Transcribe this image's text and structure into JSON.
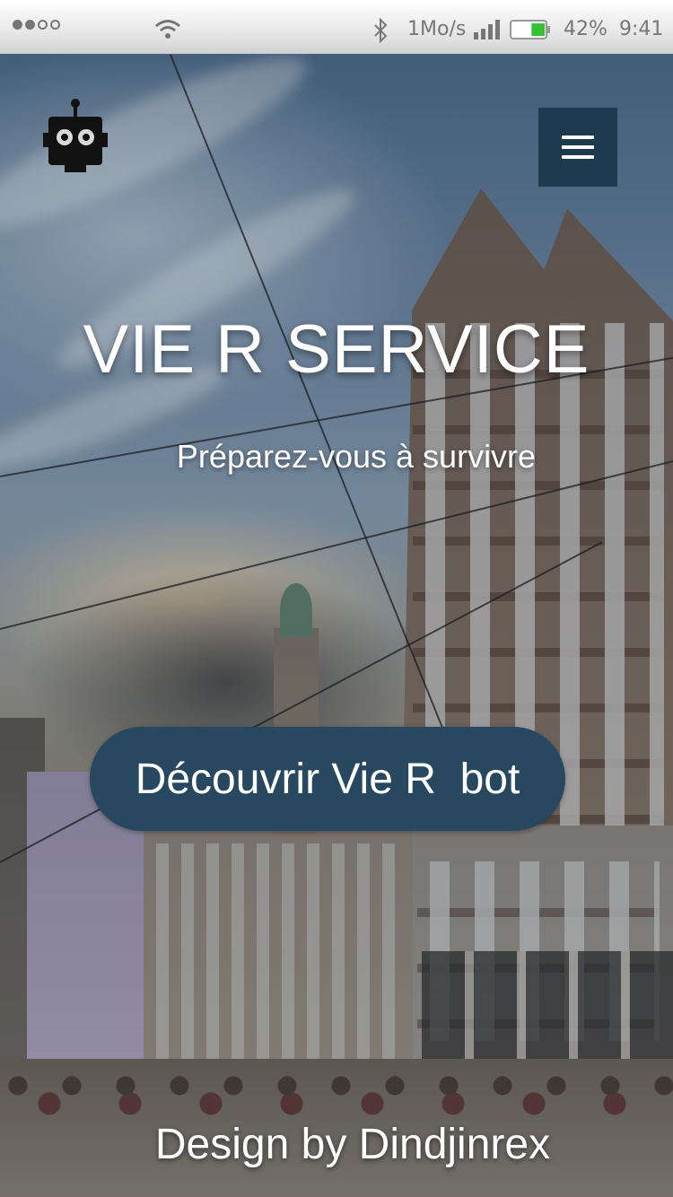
{
  "status_bar": {
    "net_speed": "1Mo/s",
    "battery_percent": "42%",
    "battery_level": 0.42,
    "time": "9:41",
    "signal_dots_filled": 2,
    "signal_dots_total": 5,
    "icons": [
      "wifi-icon",
      "bluetooth-icon",
      "signal-bars-icon",
      "battery-icon"
    ]
  },
  "header": {
    "logo_icon": "robot-icon",
    "menu_icon": "hamburger-menu-icon"
  },
  "hero": {
    "title": "VIE R SERVICE",
    "subtitle": "Préparez-vous à survivre",
    "cta_label": "Découvrir Vie R  bot",
    "footer": "Design by Dindjinrex"
  },
  "colors": {
    "menu_button_bg": "#1e3a4e",
    "cta_bg": "#27485f",
    "battery_green": "#35c335"
  }
}
